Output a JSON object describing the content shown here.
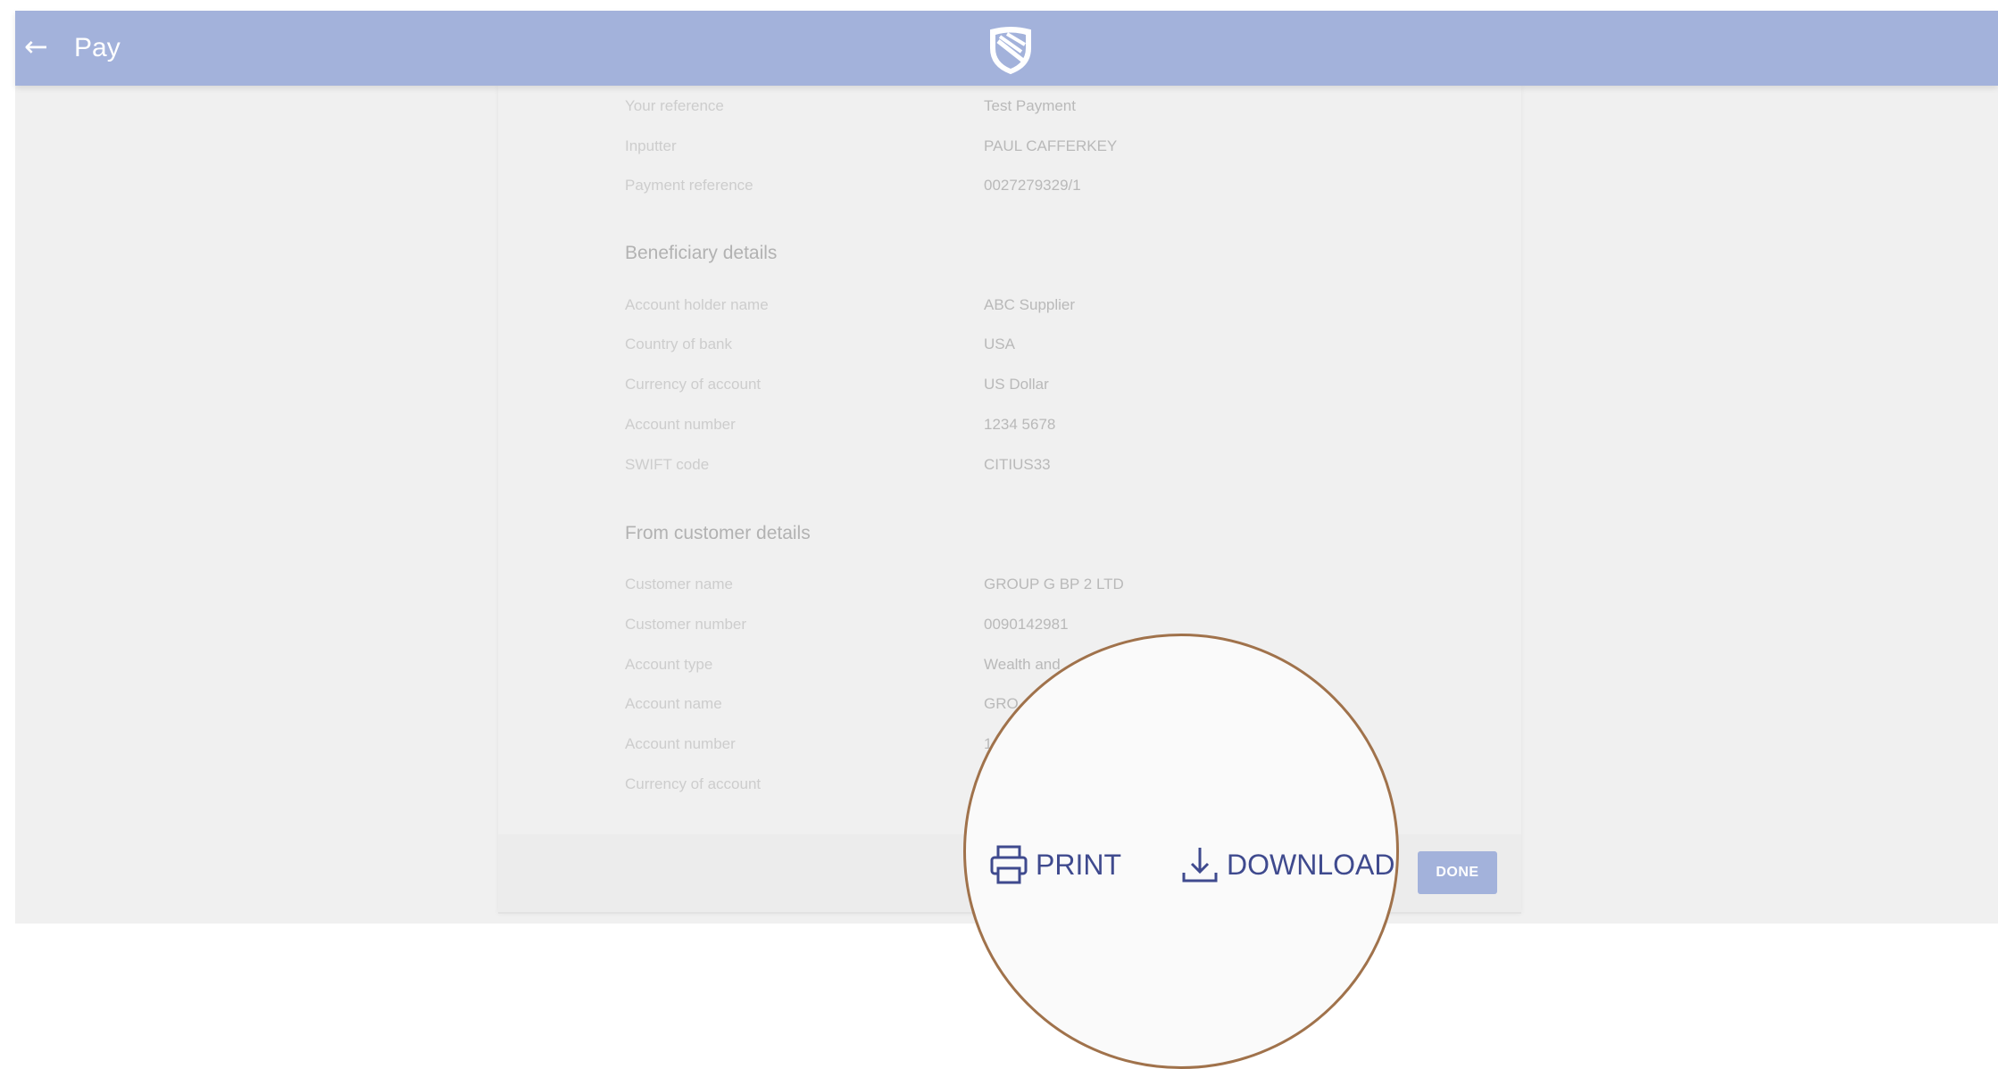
{
  "header": {
    "back_icon": "arrow-left-icon",
    "title": "Pay",
    "logo": "bank-shield-logo"
  },
  "payment_details": [
    {
      "label": "Your reference",
      "value": "Test Payment"
    },
    {
      "label": "Inputter",
      "value": "PAUL CAFFERKEY"
    },
    {
      "label": "Payment reference",
      "value": "0027279329/1"
    }
  ],
  "beneficiary": {
    "title": "Beneficiary details",
    "rows": [
      {
        "label": "Account holder name",
        "value": "ABC Supplier"
      },
      {
        "label": "Country of bank",
        "value": "USA"
      },
      {
        "label": "Currency of account",
        "value": "US Dollar"
      },
      {
        "label": "Account number",
        "value": "1234 5678"
      },
      {
        "label": "SWIFT code",
        "value": "CITIUS33"
      }
    ]
  },
  "from_customer": {
    "title": "From customer details",
    "rows": [
      {
        "label": "Customer name",
        "value": "GROUP G BP 2 LTD"
      },
      {
        "label": "Customer number",
        "value": "0090142981"
      },
      {
        "label": "Account type",
        "value": "Wealth and"
      },
      {
        "label": "Account name",
        "value": "GRO"
      },
      {
        "label": "Account number",
        "value": "1"
      },
      {
        "label": "Currency of account",
        "value": ""
      }
    ]
  },
  "actions": {
    "print_label": "PRINT",
    "print_icon": "printer-icon",
    "download_label": "DOWNLOAD",
    "download_icon": "download-icon",
    "done_label": "DONE"
  },
  "colors": {
    "header": "#a3b2db",
    "accent": "#3f4a8e",
    "magnifier_ring": "#a0724b"
  }
}
